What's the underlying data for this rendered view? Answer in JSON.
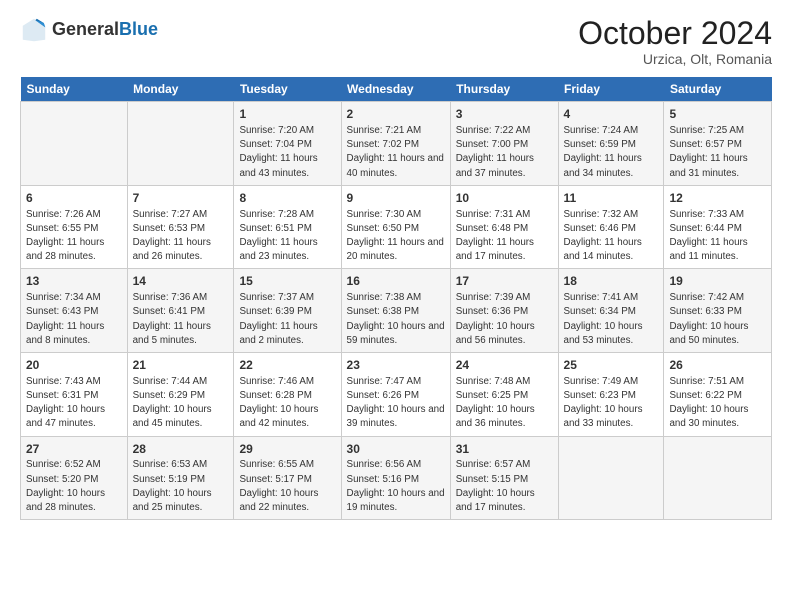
{
  "header": {
    "logo_general": "General",
    "logo_blue": "Blue",
    "month_title": "October 2024",
    "subtitle": "Urzica, Olt, Romania"
  },
  "weekdays": [
    "Sunday",
    "Monday",
    "Tuesday",
    "Wednesday",
    "Thursday",
    "Friday",
    "Saturday"
  ],
  "weeks": [
    [
      {
        "day": "",
        "info": ""
      },
      {
        "day": "",
        "info": ""
      },
      {
        "day": "1",
        "info": "Sunrise: 7:20 AM\nSunset: 7:04 PM\nDaylight: 11 hours and 43 minutes."
      },
      {
        "day": "2",
        "info": "Sunrise: 7:21 AM\nSunset: 7:02 PM\nDaylight: 11 hours and 40 minutes."
      },
      {
        "day": "3",
        "info": "Sunrise: 7:22 AM\nSunset: 7:00 PM\nDaylight: 11 hours and 37 minutes."
      },
      {
        "day": "4",
        "info": "Sunrise: 7:24 AM\nSunset: 6:59 PM\nDaylight: 11 hours and 34 minutes."
      },
      {
        "day": "5",
        "info": "Sunrise: 7:25 AM\nSunset: 6:57 PM\nDaylight: 11 hours and 31 minutes."
      }
    ],
    [
      {
        "day": "6",
        "info": "Sunrise: 7:26 AM\nSunset: 6:55 PM\nDaylight: 11 hours and 28 minutes."
      },
      {
        "day": "7",
        "info": "Sunrise: 7:27 AM\nSunset: 6:53 PM\nDaylight: 11 hours and 26 minutes."
      },
      {
        "day": "8",
        "info": "Sunrise: 7:28 AM\nSunset: 6:51 PM\nDaylight: 11 hours and 23 minutes."
      },
      {
        "day": "9",
        "info": "Sunrise: 7:30 AM\nSunset: 6:50 PM\nDaylight: 11 hours and 20 minutes."
      },
      {
        "day": "10",
        "info": "Sunrise: 7:31 AM\nSunset: 6:48 PM\nDaylight: 11 hours and 17 minutes."
      },
      {
        "day": "11",
        "info": "Sunrise: 7:32 AM\nSunset: 6:46 PM\nDaylight: 11 hours and 14 minutes."
      },
      {
        "day": "12",
        "info": "Sunrise: 7:33 AM\nSunset: 6:44 PM\nDaylight: 11 hours and 11 minutes."
      }
    ],
    [
      {
        "day": "13",
        "info": "Sunrise: 7:34 AM\nSunset: 6:43 PM\nDaylight: 11 hours and 8 minutes."
      },
      {
        "day": "14",
        "info": "Sunrise: 7:36 AM\nSunset: 6:41 PM\nDaylight: 11 hours and 5 minutes."
      },
      {
        "day": "15",
        "info": "Sunrise: 7:37 AM\nSunset: 6:39 PM\nDaylight: 11 hours and 2 minutes."
      },
      {
        "day": "16",
        "info": "Sunrise: 7:38 AM\nSunset: 6:38 PM\nDaylight: 10 hours and 59 minutes."
      },
      {
        "day": "17",
        "info": "Sunrise: 7:39 AM\nSunset: 6:36 PM\nDaylight: 10 hours and 56 minutes."
      },
      {
        "day": "18",
        "info": "Sunrise: 7:41 AM\nSunset: 6:34 PM\nDaylight: 10 hours and 53 minutes."
      },
      {
        "day": "19",
        "info": "Sunrise: 7:42 AM\nSunset: 6:33 PM\nDaylight: 10 hours and 50 minutes."
      }
    ],
    [
      {
        "day": "20",
        "info": "Sunrise: 7:43 AM\nSunset: 6:31 PM\nDaylight: 10 hours and 47 minutes."
      },
      {
        "day": "21",
        "info": "Sunrise: 7:44 AM\nSunset: 6:29 PM\nDaylight: 10 hours and 45 minutes."
      },
      {
        "day": "22",
        "info": "Sunrise: 7:46 AM\nSunset: 6:28 PM\nDaylight: 10 hours and 42 minutes."
      },
      {
        "day": "23",
        "info": "Sunrise: 7:47 AM\nSunset: 6:26 PM\nDaylight: 10 hours and 39 minutes."
      },
      {
        "day": "24",
        "info": "Sunrise: 7:48 AM\nSunset: 6:25 PM\nDaylight: 10 hours and 36 minutes."
      },
      {
        "day": "25",
        "info": "Sunrise: 7:49 AM\nSunset: 6:23 PM\nDaylight: 10 hours and 33 minutes."
      },
      {
        "day": "26",
        "info": "Sunrise: 7:51 AM\nSunset: 6:22 PM\nDaylight: 10 hours and 30 minutes."
      }
    ],
    [
      {
        "day": "27",
        "info": "Sunrise: 6:52 AM\nSunset: 5:20 PM\nDaylight: 10 hours and 28 minutes."
      },
      {
        "day": "28",
        "info": "Sunrise: 6:53 AM\nSunset: 5:19 PM\nDaylight: 10 hours and 25 minutes."
      },
      {
        "day": "29",
        "info": "Sunrise: 6:55 AM\nSunset: 5:17 PM\nDaylight: 10 hours and 22 minutes."
      },
      {
        "day": "30",
        "info": "Sunrise: 6:56 AM\nSunset: 5:16 PM\nDaylight: 10 hours and 19 minutes."
      },
      {
        "day": "31",
        "info": "Sunrise: 6:57 AM\nSunset: 5:15 PM\nDaylight: 10 hours and 17 minutes."
      },
      {
        "day": "",
        "info": ""
      },
      {
        "day": "",
        "info": ""
      }
    ]
  ]
}
